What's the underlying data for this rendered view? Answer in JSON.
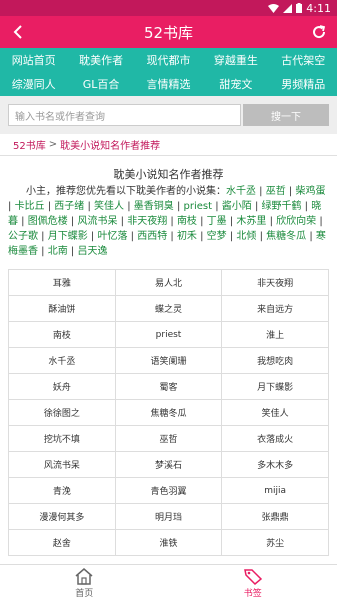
{
  "status": {
    "time": "4:11"
  },
  "appbar": {
    "title": "52书库"
  },
  "nav": [
    "网站首页",
    "耽美作者",
    "现代都市",
    "穿越重生",
    "古代架空",
    "综漫同人",
    "GL百合",
    "言情精选",
    "甜宠文",
    "男频精品"
  ],
  "search": {
    "placeholder": "输入书名或作者查询",
    "button": "搜一下"
  },
  "breadcrumb": {
    "home": "52书库",
    "sep": ">",
    "current": "耽美小说知名作者推荐"
  },
  "article": {
    "title": "耽美小说知名作者推荐",
    "intro_prefix": "小主，推荐您优先看以下耽美作者的小说集：",
    "intro_links": [
      "水千丞",
      "巫哲",
      "柴鸡蛋",
      "卡比丘",
      "西子绪",
      "笑佳人",
      "墨香铜臭",
      "priest",
      "酱小陌",
      "绿野千鹤",
      "晓暮",
      "图佩危楼",
      "风流书呆",
      "非天夜翔",
      "南枝",
      "丁墨",
      "木苏里",
      "欣欣向荣",
      "公子歌",
      "月下蝶影",
      "叶忆落",
      "西西特",
      "初禾",
      "空梦",
      "北倾",
      "焦糖冬瓜",
      "寒梅墨香",
      "北南",
      "吕天逸"
    ]
  },
  "authors": [
    "耳雅",
    "易人北",
    "非天夜翔",
    "酥油饼",
    "蝶之灵",
    "来自远方",
    "南枝",
    "priest",
    "淮上",
    "水千丞",
    "语笑阑珊",
    "我想吃肉",
    "妖舟",
    "蜀客",
    "月下蝶影",
    "徐徐图之",
    "焦糖冬瓜",
    "笑佳人",
    "挖坑不填",
    "巫哲",
    "衣落成火",
    "风流书呆",
    "梦溪石",
    "多木木多",
    "青浼",
    "青色羽翼",
    "mijia",
    "漫漫何其多",
    "明月珰",
    "张鼎鼎",
    "赵舍",
    "淮铁",
    "苏尘"
  ],
  "tabbar": {
    "home": "首页",
    "tags": "书签"
  },
  "colors": {
    "primary": "#e91e63",
    "statusbar": "#c2185b",
    "nav": "#20b8a6",
    "link": "#1a8a3c"
  }
}
